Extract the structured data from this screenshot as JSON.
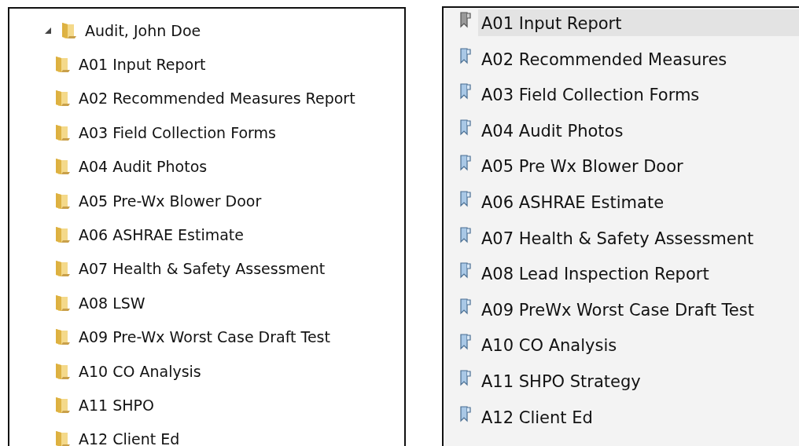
{
  "folder_tree": {
    "label": "Audit, John Doe",
    "expanded": true,
    "children": [
      {
        "label": "A01 Input Report"
      },
      {
        "label": "A02 Recommended Measures Report"
      },
      {
        "label": "A03 Field Collection Forms"
      },
      {
        "label": "A04 Audit Photos"
      },
      {
        "label": "A05 Pre-Wx Blower Door"
      },
      {
        "label": "A06 ASHRAE Estimate"
      },
      {
        "label": "A07 Health & Safety Assessment"
      },
      {
        "label": "A08 LSW"
      },
      {
        "label": "A09 Pre-Wx Worst Case Draft Test"
      },
      {
        "label": "A10 CO Analysis"
      },
      {
        "label": "A11 SHPO"
      },
      {
        "label": "A12 Client Ed"
      }
    ]
  },
  "bookmarks": [
    {
      "label": "A01 Input Report",
      "selected": true
    },
    {
      "label": "A02 Recommended Measures",
      "selected": false
    },
    {
      "label": "A03 Field Collection Forms",
      "selected": false
    },
    {
      "label": "A04 Audit Photos",
      "selected": false
    },
    {
      "label": "A05 Pre Wx Blower Door",
      "selected": false
    },
    {
      "label": "A06 ASHRAE Estimate",
      "selected": false
    },
    {
      "label": "A07 Health & Safety Assessment",
      "selected": false
    },
    {
      "label": "A08 Lead Inspection Report",
      "selected": false
    },
    {
      "label": "A09 PreWx Worst Case Draft Test",
      "selected": false
    },
    {
      "label": "A10 CO Analysis",
      "selected": false
    },
    {
      "label": "A11 SHPO Strategy",
      "selected": false
    },
    {
      "label": "A12 Client Ed",
      "selected": false
    }
  ]
}
